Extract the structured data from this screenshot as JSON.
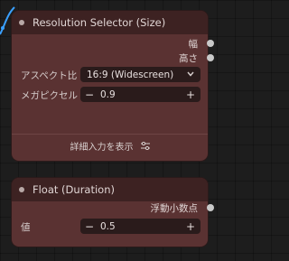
{
  "nodes": {
    "resolution": {
      "title": "Resolution Selector (Size)",
      "outputs": {
        "width": "幅",
        "height": "高さ"
      },
      "aspect": {
        "label": "アスペクト比",
        "value": "16:9 (Widescreen)"
      },
      "megapixel": {
        "label": "メガピクセル",
        "value": "0.9",
        "minus": "−",
        "plus": "+"
      },
      "footer": "詳細入力を表示"
    },
    "float": {
      "title": "Float (Duration)",
      "output": "浮動小数点",
      "value": {
        "label": "値",
        "value": "0.5",
        "minus": "−",
        "plus": "+"
      }
    }
  },
  "colors": {
    "node_body": "#5a3232",
    "node_header": "#3d2222",
    "field_bg": "#2a1b1b",
    "wire": "#3aa0ff",
    "socket": "#c9c9c9"
  }
}
